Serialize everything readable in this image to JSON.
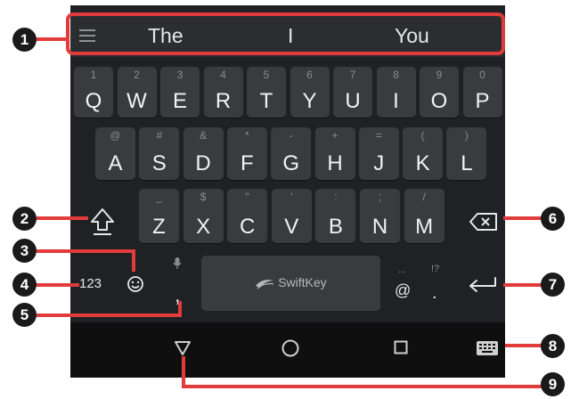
{
  "suggestions": [
    "The",
    "I",
    "You"
  ],
  "rows": [
    [
      {
        "main": "Q",
        "sec": "1"
      },
      {
        "main": "W",
        "sec": "2"
      },
      {
        "main": "E",
        "sec": "3"
      },
      {
        "main": "R",
        "sec": "4"
      },
      {
        "main": "T",
        "sec": "5"
      },
      {
        "main": "Y",
        "sec": "6"
      },
      {
        "main": "U",
        "sec": "7"
      },
      {
        "main": "I",
        "sec": "8"
      },
      {
        "main": "O",
        "sec": "9"
      },
      {
        "main": "P",
        "sec": "0"
      }
    ],
    [
      {
        "main": "A",
        "sec": "@"
      },
      {
        "main": "S",
        "sec": "#"
      },
      {
        "main": "D",
        "sec": "&"
      },
      {
        "main": "F",
        "sec": "*"
      },
      {
        "main": "G",
        "sec": "-"
      },
      {
        "main": "H",
        "sec": "+"
      },
      {
        "main": "J",
        "sec": "="
      },
      {
        "main": "K",
        "sec": "("
      },
      {
        "main": "L",
        "sec": ")"
      }
    ],
    [
      {
        "main": "Z",
        "sec": "_"
      },
      {
        "main": "X",
        "sec": "$"
      },
      {
        "main": "C",
        "sec": "\""
      },
      {
        "main": "V",
        "sec": "'"
      },
      {
        "main": "B",
        "sec": ":"
      },
      {
        "main": "N",
        "sec": ";"
      },
      {
        "main": "M",
        "sec": "/"
      }
    ]
  ],
  "bottom_row": {
    "num_label": "123",
    "comma": ",",
    "space_brand": "SwiftKey",
    "at": "@",
    "at_hint": "...",
    "period": ".",
    "period_hint": "!?"
  },
  "callouts": [
    "1",
    "2",
    "3",
    "4",
    "5",
    "6",
    "7",
    "8",
    "9"
  ],
  "colors": {
    "callout": "#e23b3b",
    "keyboard_bg": "#202124",
    "key_bg": "#3a3b3e"
  }
}
